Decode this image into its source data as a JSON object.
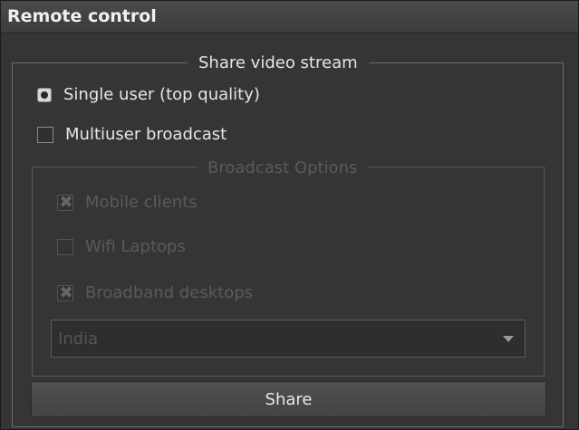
{
  "window": {
    "title": "Remote control"
  },
  "share_group": {
    "title": "Share video stream",
    "options": [
      {
        "label": "Single user (top quality)",
        "selected": true
      },
      {
        "label": "Multiuser broadcast",
        "selected": false
      }
    ]
  },
  "broadcast_group": {
    "title": "Broadcast Options",
    "enabled": false,
    "checkboxes": [
      {
        "label": "Mobile clients",
        "checked": true,
        "mark": "✖"
      },
      {
        "label": "Wifi Laptops",
        "checked": false,
        "mark": ""
      },
      {
        "label": "Broadband desktops",
        "checked": true,
        "mark": "✖"
      }
    ],
    "region_select": {
      "value": "India"
    }
  },
  "share_button": {
    "label": "Share"
  }
}
